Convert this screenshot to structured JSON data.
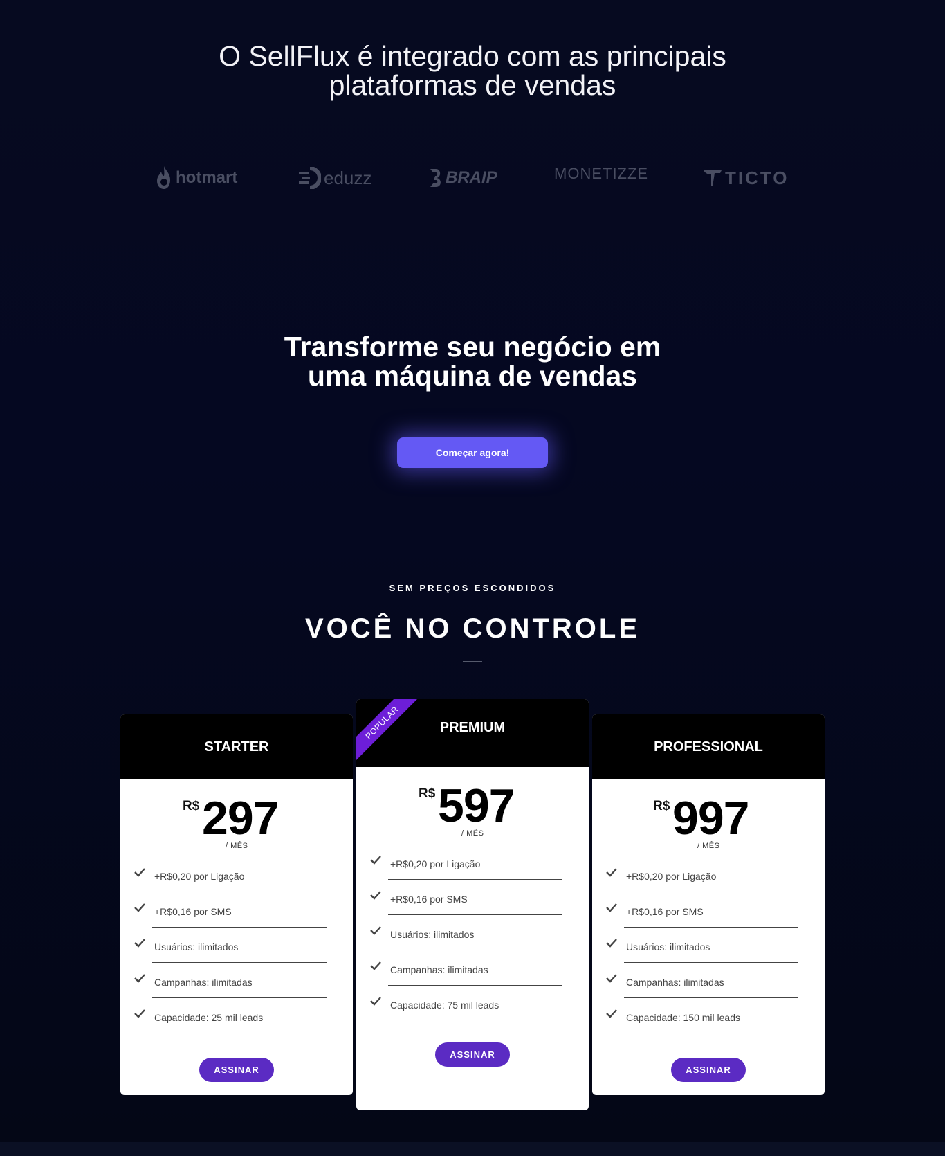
{
  "integrations": {
    "title_line1": "O SellFlux é integrado com as principais",
    "title_line2": "plataformas de vendas",
    "logos": [
      {
        "name": "hotmart",
        "icon": "hotmart-flame-icon"
      },
      {
        "name": "eduzz",
        "icon": "eduzz-lines-icon"
      },
      {
        "name": "BRAIP",
        "icon": "braip-b-icon"
      },
      {
        "name": "MONETIZZE",
        "icon": ""
      },
      {
        "name": "TICTO",
        "icon": "ticto-t-icon"
      }
    ]
  },
  "hero": {
    "title_line1": "Transforme seu negócio em",
    "title_line2": "uma máquina de vendas",
    "cta_label": "Começar agora!"
  },
  "pricing": {
    "eyebrow": "SEM PREÇOS ESCONDIDOS",
    "title": "VOCÊ NO CONTROLE",
    "plans": [
      {
        "name": "STARTER",
        "currency": "R$",
        "price": "297",
        "period": "/ MÊS",
        "features": [
          "+R$0,20 por Ligação",
          "+R$0,16 por SMS",
          "Usuários: ilimitados",
          "Campanhas: ilimitadas",
          "Capacidade: 25 mil leads"
        ],
        "button": "ASSINAR"
      },
      {
        "name": "PREMIUM",
        "badge": "POPULAR",
        "currency": "R$",
        "price": "597",
        "period": "/ MÊS",
        "features": [
          "+R$0,20 por Ligação",
          "+R$0,16 por SMS",
          "Usuários: ilimitados",
          "Campanhas: ilimitadas",
          "Capacidade: 75 mil leads"
        ],
        "button": "ASSINAR"
      },
      {
        "name": "PROFESSIONAL",
        "currency": "R$",
        "price": "997",
        "period": "/ MÊS",
        "features": [
          "+R$0,20 por Ligação",
          "+R$0,16 por SMS",
          "Usuários: ilimitados",
          "Campanhas: ilimitadas",
          "Capacidade: 150 mil leads"
        ],
        "button": "ASSINAR"
      }
    ]
  },
  "colors": {
    "background": "#05081d",
    "cta": "#6459f4",
    "assinar": "#5b2bc3",
    "ribbon": "#6d1ed8",
    "logo_gray": "#4a4e62"
  }
}
